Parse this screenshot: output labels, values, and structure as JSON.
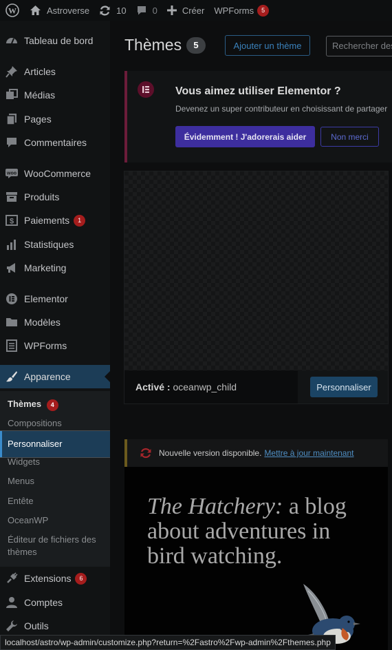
{
  "admin_bar": {
    "site_name": "Astroverse",
    "updates_count": "10",
    "comments_count": "0",
    "create_label": "Créer",
    "wpforms_label": "WPForms",
    "wpforms_badge": "5"
  },
  "sidebar": {
    "items": [
      {
        "label": "Tableau de bord",
        "icon": "dashboard-icon"
      },
      {
        "label": "Articles",
        "icon": "pin-icon"
      },
      {
        "label": "Médias",
        "icon": "media-icon"
      },
      {
        "label": "Pages",
        "icon": "pages-icon"
      },
      {
        "label": "Commentaires",
        "icon": "comment-icon"
      },
      {
        "label": "WooCommerce",
        "icon": "woo-icon"
      },
      {
        "label": "Produits",
        "icon": "archive-icon"
      },
      {
        "label": "Paiements",
        "icon": "payment-icon",
        "badge": "1"
      },
      {
        "label": "Statistiques",
        "icon": "chart-icon"
      },
      {
        "label": "Marketing",
        "icon": "megaphone-icon"
      },
      {
        "label": "Elementor",
        "icon": "elementor-icon"
      },
      {
        "label": "Modèles",
        "icon": "folder-icon"
      },
      {
        "label": "WPForms",
        "icon": "form-icon"
      },
      {
        "label": "Apparence",
        "icon": "brush-icon"
      },
      {
        "label": "Extensions",
        "icon": "plugin-icon",
        "badge": "6"
      },
      {
        "label": "Comptes",
        "icon": "user-icon"
      },
      {
        "label": "Outils",
        "icon": "wrench-icon"
      }
    ],
    "submenu": {
      "themes": "Thèmes",
      "themes_badge": "4",
      "compositions": "Compositions",
      "personnaliser": "Personnaliser",
      "widgets": "Widgets",
      "menus": "Menus",
      "entete": "Entête",
      "oceanwp": "OceanWP",
      "editor": "Éditeur de fichiers des thèmes"
    }
  },
  "page": {
    "title": "Thèmes",
    "count": "5",
    "add_theme": "Ajouter un thème",
    "search_placeholder": "Rechercher des thèmes..."
  },
  "elementor_notice": {
    "title": "Vous aimez utiliser Elementor ?",
    "text": "Devenez un super contributeur en choisissant de partager",
    "primary": "Évidemment ! J'adorerais aider",
    "secondary": "Non merci"
  },
  "active_theme": {
    "active_prefix": "Activé :",
    "name": "oceanwp_child",
    "customize": "Personnaliser"
  },
  "second_theme": {
    "update_text": "Nouvelle version disponible.",
    "update_link": "Mettre à jour maintenant",
    "preview_italic": "The Hatchery:",
    "preview_rest": "a blog about adventures in bird watching."
  },
  "status_bar": {
    "url": "localhost/astro/wp-admin/customize.php?return=%2Fastro%2Fwp-admin%2Fthemes.php"
  },
  "colors": {
    "admin_bg": "#0d0f10",
    "sidebar_bg": "#111314",
    "active_menu": "#1c3d57",
    "badge_red": "#a51d1d",
    "elementor_accent": "#5c0f2a",
    "primary_button": "#3d2e9e"
  }
}
